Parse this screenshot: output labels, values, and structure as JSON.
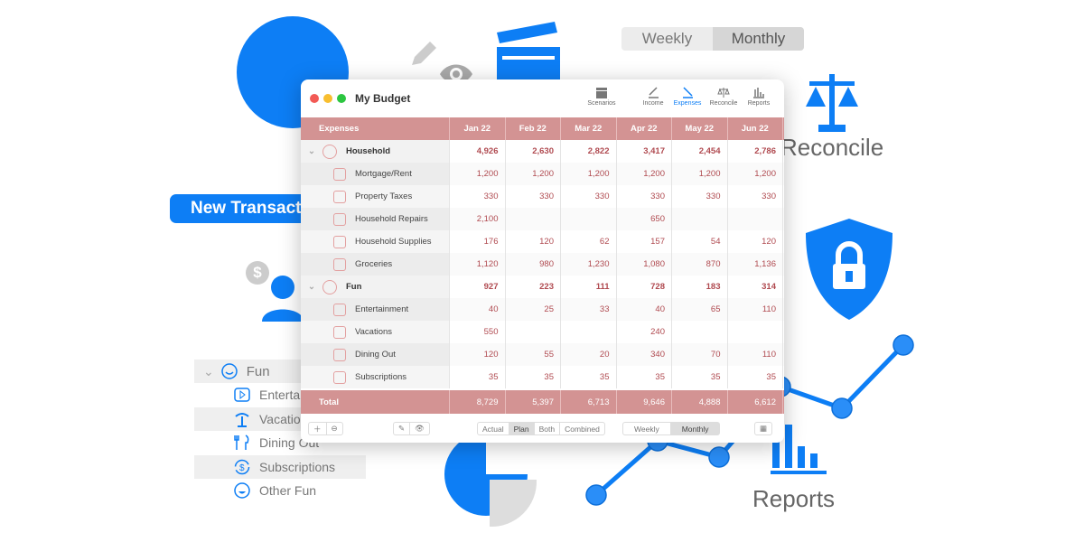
{
  "promo": {
    "toggle": {
      "weekly": "Weekly",
      "monthly": "Monthly",
      "selected": "Monthly"
    },
    "reconcile_label": "Reconcile",
    "reports_label": "Reports",
    "new_transaction": "New Transaction",
    "accent": "#0d7ef5"
  },
  "sidebar": {
    "group": "Fun",
    "items": [
      {
        "label": "Entertainment",
        "icon": "play-icon"
      },
      {
        "label": "Vacations",
        "icon": "palm-tree-icon"
      },
      {
        "label": "Dining Out",
        "icon": "fork-knife-icon"
      },
      {
        "label": "Subscriptions",
        "icon": "dollar-cycle-icon"
      },
      {
        "label": "Other Fun",
        "icon": "smiley-icon"
      }
    ]
  },
  "window": {
    "title": "My Budget",
    "toolbar": {
      "scenarios": "Scenarios",
      "income": "Income",
      "expenses": "Expenses",
      "reconcile": "Reconcile",
      "reports": "Reports"
    },
    "table": {
      "header": "Expenses",
      "months": [
        "Jan 22",
        "Feb 22",
        "Mar 22",
        "Apr 22",
        "May 22",
        "Jun 22"
      ],
      "rows": [
        {
          "type": "group",
          "label": "Household",
          "values": [
            "4,926",
            "2,630",
            "2,822",
            "3,417",
            "2,454",
            "2,786"
          ]
        },
        {
          "type": "item",
          "label": "Mortgage/Rent",
          "values": [
            "1,200",
            "1,200",
            "1,200",
            "1,200",
            "1,200",
            "1,200"
          ]
        },
        {
          "type": "item",
          "label": "Property Taxes",
          "values": [
            "330",
            "330",
            "330",
            "330",
            "330",
            "330"
          ]
        },
        {
          "type": "item",
          "label": "Household Repairs",
          "values": [
            "2,100",
            "",
            "",
            "650",
            "",
            ""
          ]
        },
        {
          "type": "item",
          "label": "Household Supplies",
          "values": [
            "176",
            "120",
            "62",
            "157",
            "54",
            "120"
          ]
        },
        {
          "type": "item",
          "label": "Groceries",
          "values": [
            "1,120",
            "980",
            "1,230",
            "1,080",
            "870",
            "1,136"
          ]
        },
        {
          "type": "group",
          "label": "Fun",
          "values": [
            "927",
            "223",
            "111",
            "728",
            "183",
            "314"
          ]
        },
        {
          "type": "item",
          "label": "Entertainment",
          "values": [
            "40",
            "25",
            "33",
            "40",
            "65",
            "110"
          ]
        },
        {
          "type": "item",
          "label": "Vacations",
          "values": [
            "550",
            "",
            "",
            "240",
            "",
            ""
          ]
        },
        {
          "type": "item",
          "label": "Dining Out",
          "values": [
            "120",
            "55",
            "20",
            "340",
            "70",
            "110"
          ]
        },
        {
          "type": "item",
          "label": "Subscriptions",
          "values": [
            "35",
            "35",
            "35",
            "35",
            "35",
            "35"
          ]
        }
      ],
      "total": {
        "label": "Total",
        "values": [
          "8,729",
          "5,397",
          "6,713",
          "9,646",
          "4,888",
          "6,612"
        ]
      },
      "header_color": "#d39393"
    },
    "footer": {
      "modes": [
        "Actual",
        "Plan",
        "Both",
        "Combined"
      ],
      "mode_selected": "Plan",
      "periods": [
        "Weekly",
        "Monthly"
      ],
      "period_selected": "Monthly"
    }
  }
}
